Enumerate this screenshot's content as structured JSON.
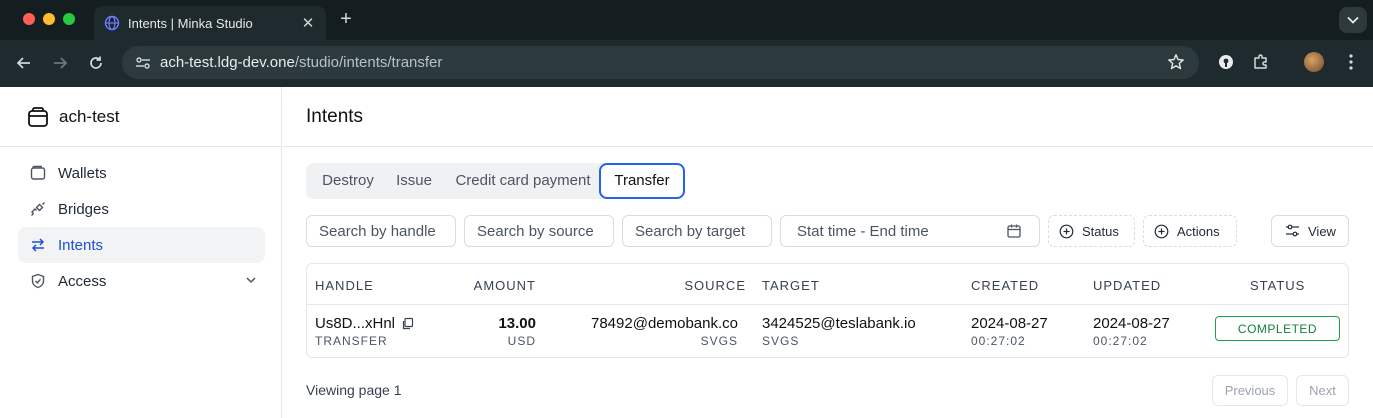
{
  "browser": {
    "tab_title": "Intents | Minka Studio",
    "url_host": "ach-test.ldg-dev.one",
    "url_path": "/studio/intents/transfer"
  },
  "sidebar": {
    "workspace": "ach-test",
    "items": [
      {
        "label": "Wallets",
        "icon": "wallet-icon"
      },
      {
        "label": "Bridges",
        "icon": "plug-icon"
      },
      {
        "label": "Intents",
        "icon": "transfer-arrows-icon",
        "active": true
      },
      {
        "label": "Access",
        "icon": "shield-icon",
        "expandable": true
      }
    ]
  },
  "main": {
    "title": "Intents",
    "tabs": [
      {
        "label": "Destroy"
      },
      {
        "label": "Issue"
      },
      {
        "label": "Credit card payment"
      },
      {
        "label": "Transfer",
        "active": true
      }
    ],
    "filters": {
      "handle_placeholder": "Search by handle",
      "source_placeholder": "Search by source",
      "target_placeholder": "Search by target",
      "date_range_placeholder": "Stat time - End time",
      "status_label": "Status",
      "actions_label": "Actions",
      "view_label": "View"
    },
    "table": {
      "columns": [
        "HANDLE",
        "AMOUNT",
        "SOURCE",
        "TARGET",
        "CREATED",
        "UPDATED",
        "STATUS"
      ],
      "rows": [
        {
          "handle": "Us8D...xHnl",
          "type": "TRANSFER",
          "amount": "13.00",
          "currency": "USD",
          "source": "78492@demobank.co",
          "source_symbol": "SVGS",
          "target": "3424525@teslabank.io",
          "target_symbol": "SVGS",
          "created_date": "2024-08-27",
          "created_time": "00:27:02",
          "updated_date": "2024-08-27",
          "updated_time": "00:27:02",
          "status": "COMPLETED"
        }
      ]
    },
    "pagination": {
      "viewing": "Viewing page 1",
      "previous": "Previous",
      "next": "Next"
    }
  },
  "colors": {
    "accent": "#2563eb",
    "status_completed": "#16a34a",
    "chrome_bg": "#1f2a2e"
  }
}
